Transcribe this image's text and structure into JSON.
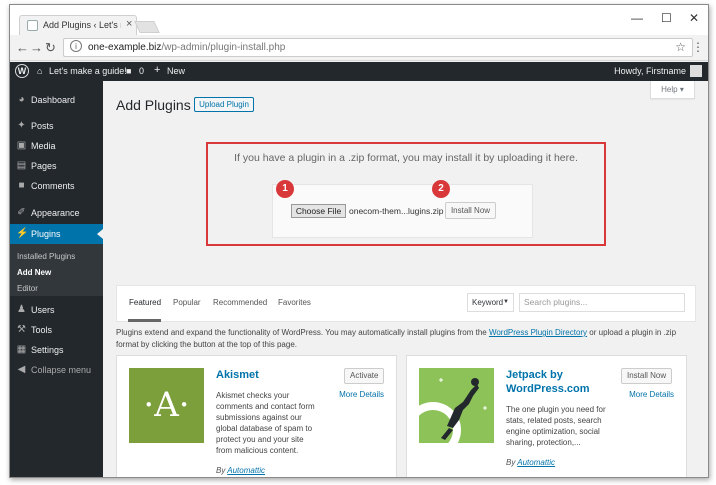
{
  "browser": {
    "tab_title": "Add Plugins ‹ Let's make a",
    "tab_close": "×",
    "url_host": "one-example.biz",
    "url_path": "/wp-admin/plugin-install.php",
    "window_controls": [
      "—",
      "☐",
      "✕"
    ]
  },
  "adminbar": {
    "site_name": "Let's make a guide!",
    "comments_count": "0",
    "new_label": "New",
    "howdy": "Howdy, Firstname"
  },
  "sidebar": {
    "items": [
      {
        "label": "Dashboard",
        "icon": "dashboard-icon"
      },
      {
        "label": "Posts",
        "icon": "pin-icon"
      },
      {
        "label": "Media",
        "icon": "media-icon"
      },
      {
        "label": "Pages",
        "icon": "pages-icon"
      },
      {
        "label": "Comments",
        "icon": "comments-icon"
      },
      {
        "label": "Appearance",
        "icon": "brush-icon"
      },
      {
        "label": "Plugins",
        "icon": "plug-icon"
      },
      {
        "label": "Users",
        "icon": "user-icon"
      },
      {
        "label": "Tools",
        "icon": "wrench-icon"
      },
      {
        "label": "Settings",
        "icon": "settings-icon"
      },
      {
        "label": "Collapse menu",
        "icon": "collapse-icon"
      }
    ],
    "submenu": [
      "Installed Plugins",
      "Add New",
      "Editor"
    ]
  },
  "main": {
    "title": "Add Plugins",
    "upload_button": "Upload Plugin",
    "help": "Help ▾",
    "upload_text": "If you have a plugin in a .zip format, you may install it by uploading it here.",
    "choose_file": "Choose File",
    "file_name": "onecom-them...lugins.zip",
    "install_now": "Install Now",
    "badges": [
      "1",
      "2"
    ],
    "filter_tabs": [
      "Featured",
      "Popular",
      "Recommended",
      "Favorites"
    ],
    "search_type": "Keyword",
    "search_placeholder": "Search plugins...",
    "intro_before": "Plugins extend and expand the functionality of WordPress. You may automatically install plugins from the ",
    "intro_link": "WordPress Plugin Directory",
    "intro_after": " or upload a plugin in .zip format by clicking the button at the top of this page."
  },
  "plugins": [
    {
      "name": "Akismet",
      "description": "Akismet checks your comments and contact form submissions against our global database of spam to protect you and your site from malicious content.",
      "author_prefix": "By ",
      "author": "Automattic",
      "action": "Activate",
      "more": "More Details",
      "icon_letter": "·A·",
      "icon_color": "#7c9e3b"
    },
    {
      "name": "Jetpack by WordPress.com",
      "description": "The one plugin you need for stats, related posts, search engine optimization, social sharing, protection,...",
      "author_prefix": "By ",
      "author": "Automattic",
      "action": "Install Now",
      "more": "More Details",
      "icon_color": "#8cc258"
    }
  ],
  "colors": {
    "admin_dark": "#23282d",
    "accent_blue": "#0073aa",
    "highlight_red": "#d9383b"
  }
}
